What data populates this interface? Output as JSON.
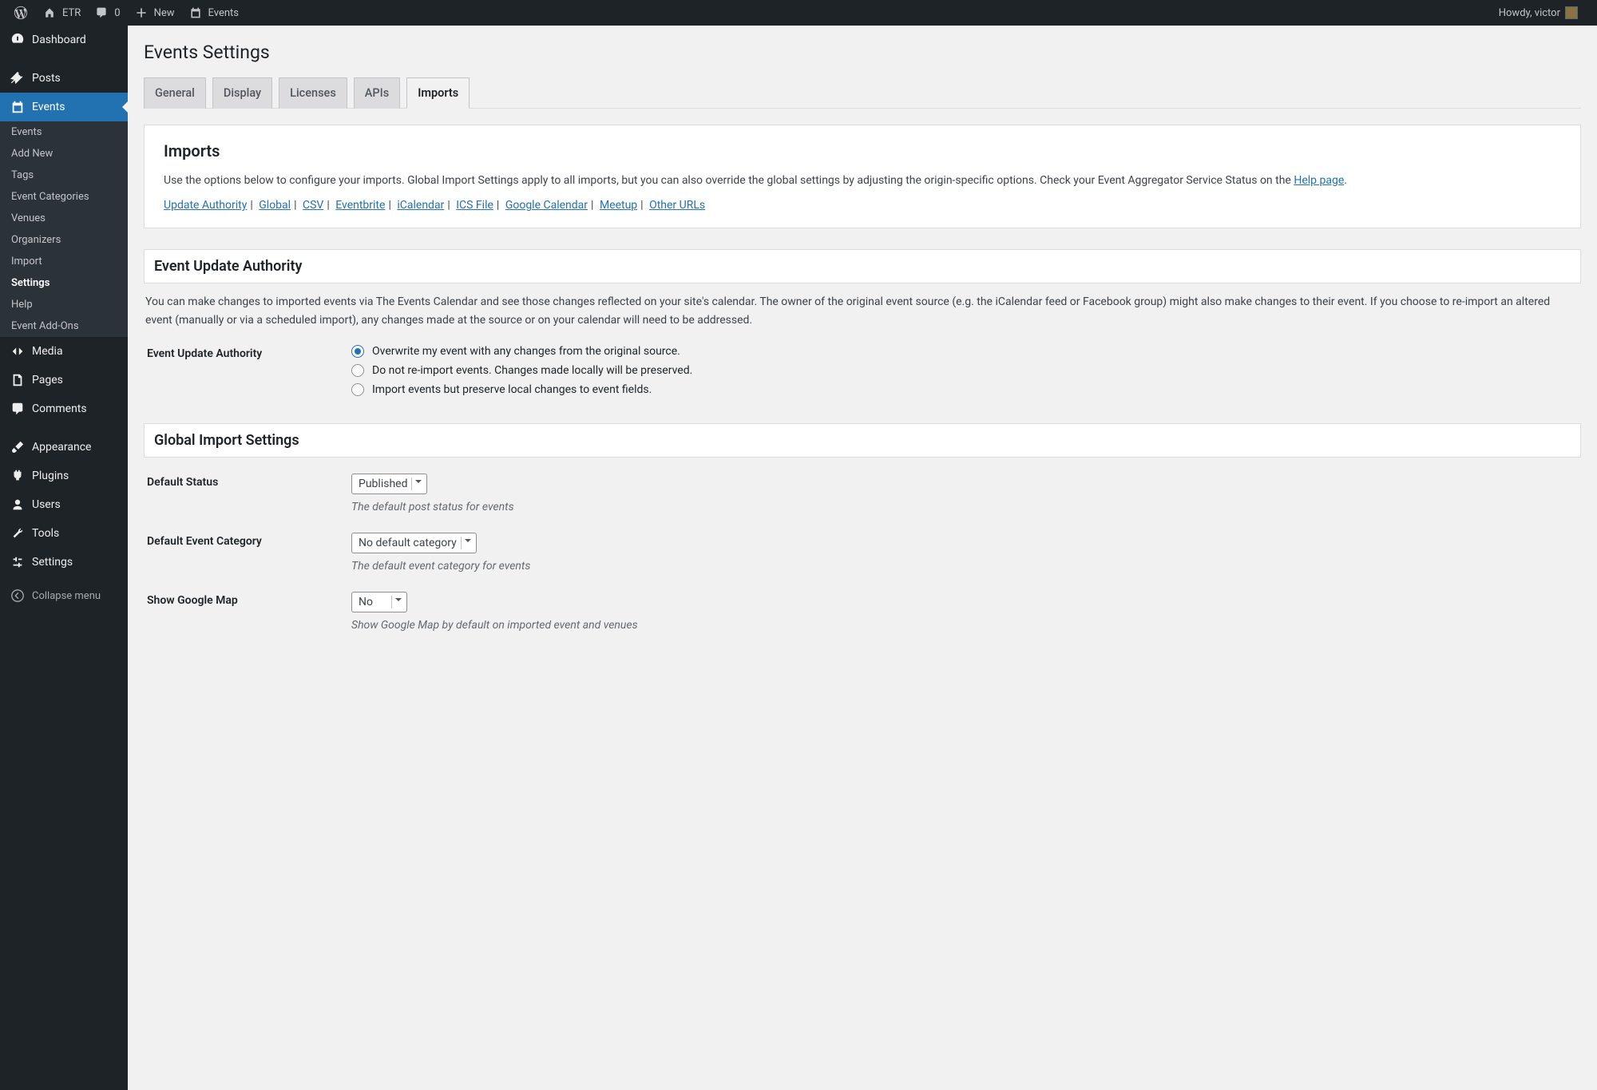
{
  "topbar": {
    "site_name": "ETR",
    "comment_count": "0",
    "new_label": "New",
    "events_label": "Events",
    "howdy": "Howdy, victor"
  },
  "sidebar": {
    "dashboard": "Dashboard",
    "posts": "Posts",
    "events": "Events",
    "submenu": {
      "events": "Events",
      "add_new": "Add New",
      "tags": "Tags",
      "categories": "Event Categories",
      "venues": "Venues",
      "organizers": "Organizers",
      "import": "Import",
      "settings": "Settings",
      "help": "Help",
      "addons": "Event Add-Ons"
    },
    "media": "Media",
    "pages": "Pages",
    "comments": "Comments",
    "appearance": "Appearance",
    "plugins": "Plugins",
    "users": "Users",
    "tools": "Tools",
    "settings": "Settings",
    "collapse": "Collapse menu"
  },
  "page": {
    "title": "Events Settings",
    "tabs": {
      "general": "General",
      "display": "Display",
      "licenses": "Licenses",
      "apis": "APIs",
      "imports": "Imports"
    }
  },
  "imports_panel": {
    "title": "Imports",
    "desc_part1": "Use the options below to configure your imports. Global Import Settings apply to all imports, but you can also override the global settings by adjusting the origin-specific options. Check your Event Aggregator Service Status on the ",
    "help_link": "Help page",
    "links": {
      "update_authority": "Update Authority",
      "global": "Global",
      "csv": "CSV",
      "eventbrite": "Eventbrite",
      "icalendar": "iCalendar",
      "ics": "ICS File",
      "google_cal": "Google Calendar",
      "meetup": "Meetup",
      "other": "Other URLs"
    }
  },
  "update_auth": {
    "title": "Event Update Authority",
    "desc": "You can make changes to imported events via The Events Calendar and see those changes reflected on your site's calendar. The owner of the original event source (e.g. the iCalendar feed or Facebook group) might also make changes to their event. If you choose to re-import an altered event (manually or via a scheduled import), any changes made at the source or on your calendar will need to be addressed.",
    "field_label": "Event Update Authority",
    "options": {
      "overwrite": "Overwrite my event with any changes from the original source.",
      "no_reimport": "Do not re-import events. Changes made locally will be preserved.",
      "preserve": "Import events but preserve local changes to event fields."
    }
  },
  "global_import": {
    "title": "Global Import Settings",
    "default_status": {
      "label": "Default Status",
      "value": "Published",
      "desc": "The default post status for events"
    },
    "default_category": {
      "label": "Default Event Category",
      "value": "No default category",
      "desc": "The default event category for events"
    },
    "google_map": {
      "label": "Show Google Map",
      "value": "No",
      "desc": "Show Google Map by default on imported event and venues"
    }
  }
}
